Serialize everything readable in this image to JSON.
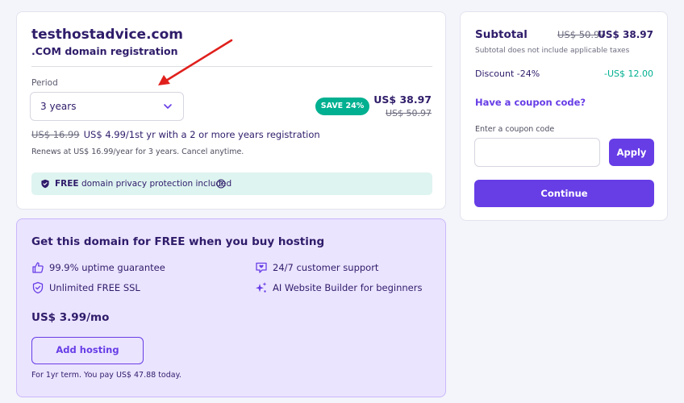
{
  "domain": {
    "name": "testhostadvice.com",
    "subtitle": ".COM domain registration",
    "period_label": "Period",
    "period_value": "3 years",
    "save_badge": "SAVE 24%",
    "price_now": "US$ 38.97",
    "price_was": "US$ 50.97",
    "promo_old": "US$ 16.99",
    "promo_text": "US$ 4.99/1st yr with a 2 or more years registration",
    "renew_text": "Renews at US$ 16.99/year for 3 years. Cancel anytime.",
    "privacy_bold": "FREE",
    "privacy_text": " domain privacy protection included"
  },
  "hosting": {
    "title": "Get this domain for FREE when you buy hosting",
    "features": [
      {
        "label": "99.9% uptime guarantee",
        "icon": "thumbs-up-icon"
      },
      {
        "label": "24/7 customer support",
        "icon": "support-chat-icon"
      },
      {
        "label": "Unlimited FREE SSL",
        "icon": "shield-check-icon"
      },
      {
        "label": "AI Website Builder for beginners",
        "icon": "sparkles-icon"
      }
    ],
    "price": "US$ 3.99/mo",
    "add_button": "Add hosting",
    "term": "For 1yr term. You pay US$ 47.88 today."
  },
  "summary": {
    "subtotal_label": "Subtotal",
    "subtotal_was": "US$ 50.97",
    "subtotal_now": "US$ 38.97",
    "note": "Subtotal does not include applicable taxes",
    "discount_label": "Discount -24%",
    "discount_value": "-US$ 12.00",
    "coupon_link": "Have a coupon code?",
    "coupon_label": "Enter a coupon code",
    "coupon_placeholder": "",
    "apply_button": "Apply",
    "continue_button": "Continue"
  },
  "colors": {
    "brand": "#673de6",
    "success": "#00b090",
    "text": "#2f1c6a",
    "annotation": "#e0201c"
  }
}
